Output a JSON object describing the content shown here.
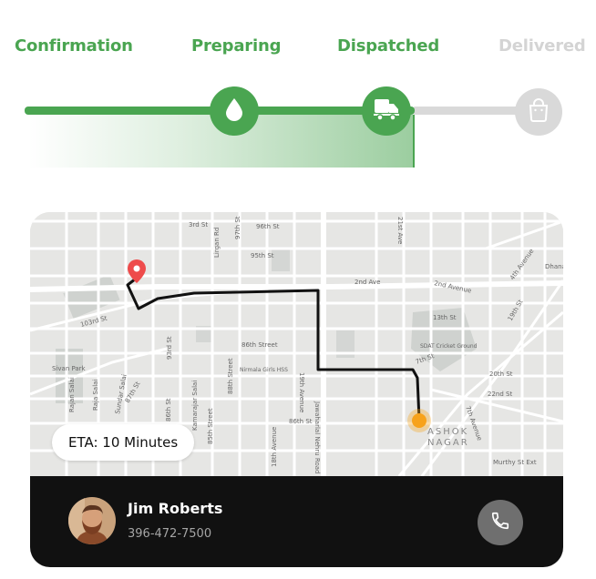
{
  "progress": {
    "steps": [
      {
        "label": "Confirmation",
        "state": "done"
      },
      {
        "label": "Preparing",
        "state": "done"
      },
      {
        "label": "Dispatched",
        "state": "current"
      },
      {
        "label": "Delivered",
        "state": "pending"
      }
    ],
    "icons": [
      "droplet-icon",
      "truck-icon",
      "shopping-bag-icon"
    ],
    "colors": {
      "active": "#4aa551",
      "pending": "#d9d9d9"
    }
  },
  "map": {
    "street_labels": [
      "3rd St",
      "96th St",
      "95th St",
      "97th St",
      "Lirgan Rd",
      "21st Ave",
      "2nd Ave",
      "2nd Avenue",
      "4th Avenue",
      "Dhana",
      "13th St",
      "19th St",
      "103rd St",
      "86th Street",
      "Nirmala Girls HSS",
      "19th Avenue",
      "Jawaharlal Nehru Road",
      "SDAT Cricket Ground",
      "7th St",
      "20th St",
      "22nd St",
      "7th Avenue",
      "Sivan Park",
      "Rajan Salai",
      "Raja Salai",
      "Sundar Salai",
      "87th St",
      "93rd St",
      "86th St",
      "Kamarajar Salai",
      "85th Street",
      "88th Street",
      "86th St",
      "18th Avenue",
      "Murthy St Ext",
      "ASHOK",
      "NAGAR"
    ],
    "eta": "ETA: 10 Minutes"
  },
  "driver": {
    "name": "Jim Roberts",
    "phone": "396-472-7500",
    "call_icon": "phone-icon"
  }
}
